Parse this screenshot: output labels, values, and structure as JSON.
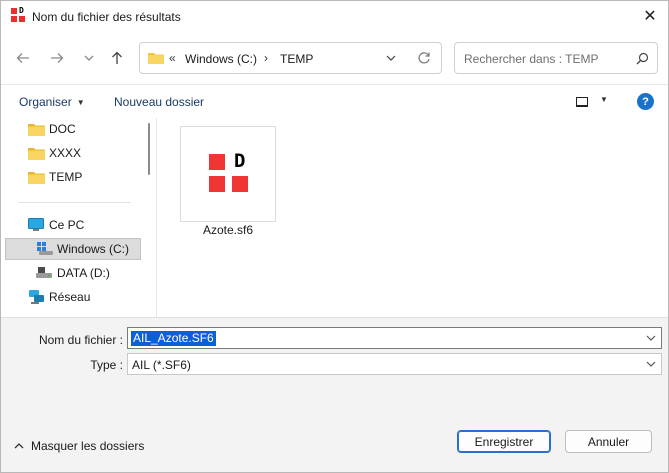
{
  "window": {
    "title": "Nom du fichier des résultats",
    "close_glyph": "✕"
  },
  "nav": {
    "path_prefix": "«",
    "path": [
      "Windows (C:)",
      "TEMP"
    ],
    "path_separator": "›",
    "search_placeholder": "Rechercher dans : TEMP"
  },
  "commands": {
    "organize": "Organiser",
    "new_folder": "Nouveau dossier",
    "help_glyph": "?"
  },
  "sidebar": {
    "items": [
      {
        "label": "DOC",
        "icon": "folder-icon"
      },
      {
        "label": "XXXX",
        "icon": "folder-icon"
      },
      {
        "label": "TEMP",
        "icon": "folder-icon"
      },
      {
        "label": "Ce PC",
        "icon": "computer-icon"
      },
      {
        "label": "Windows (C:)",
        "icon": "windows-drive-icon",
        "selected": true
      },
      {
        "label": "DATA (D:)",
        "icon": "drive-icon"
      },
      {
        "label": "Réseau",
        "icon": "network-icon"
      }
    ]
  },
  "files": [
    {
      "name": "Azote.sf6",
      "icon_letter": "D"
    }
  ],
  "form": {
    "filename_label": "Nom du fichier :",
    "filename_value": "AIL_Azote.SF6",
    "type_label": "Type :",
    "type_value": "AIL (*.SF6)"
  },
  "footer": {
    "hide_folders": "Masquer les dossiers",
    "save": "Enregistrer",
    "cancel": "Annuler"
  },
  "colors": {
    "accent": "#0a60d8",
    "app_icon_red": "#f03535",
    "folder_yellow": "#f5c542",
    "help_blue": "#1a73c8"
  }
}
